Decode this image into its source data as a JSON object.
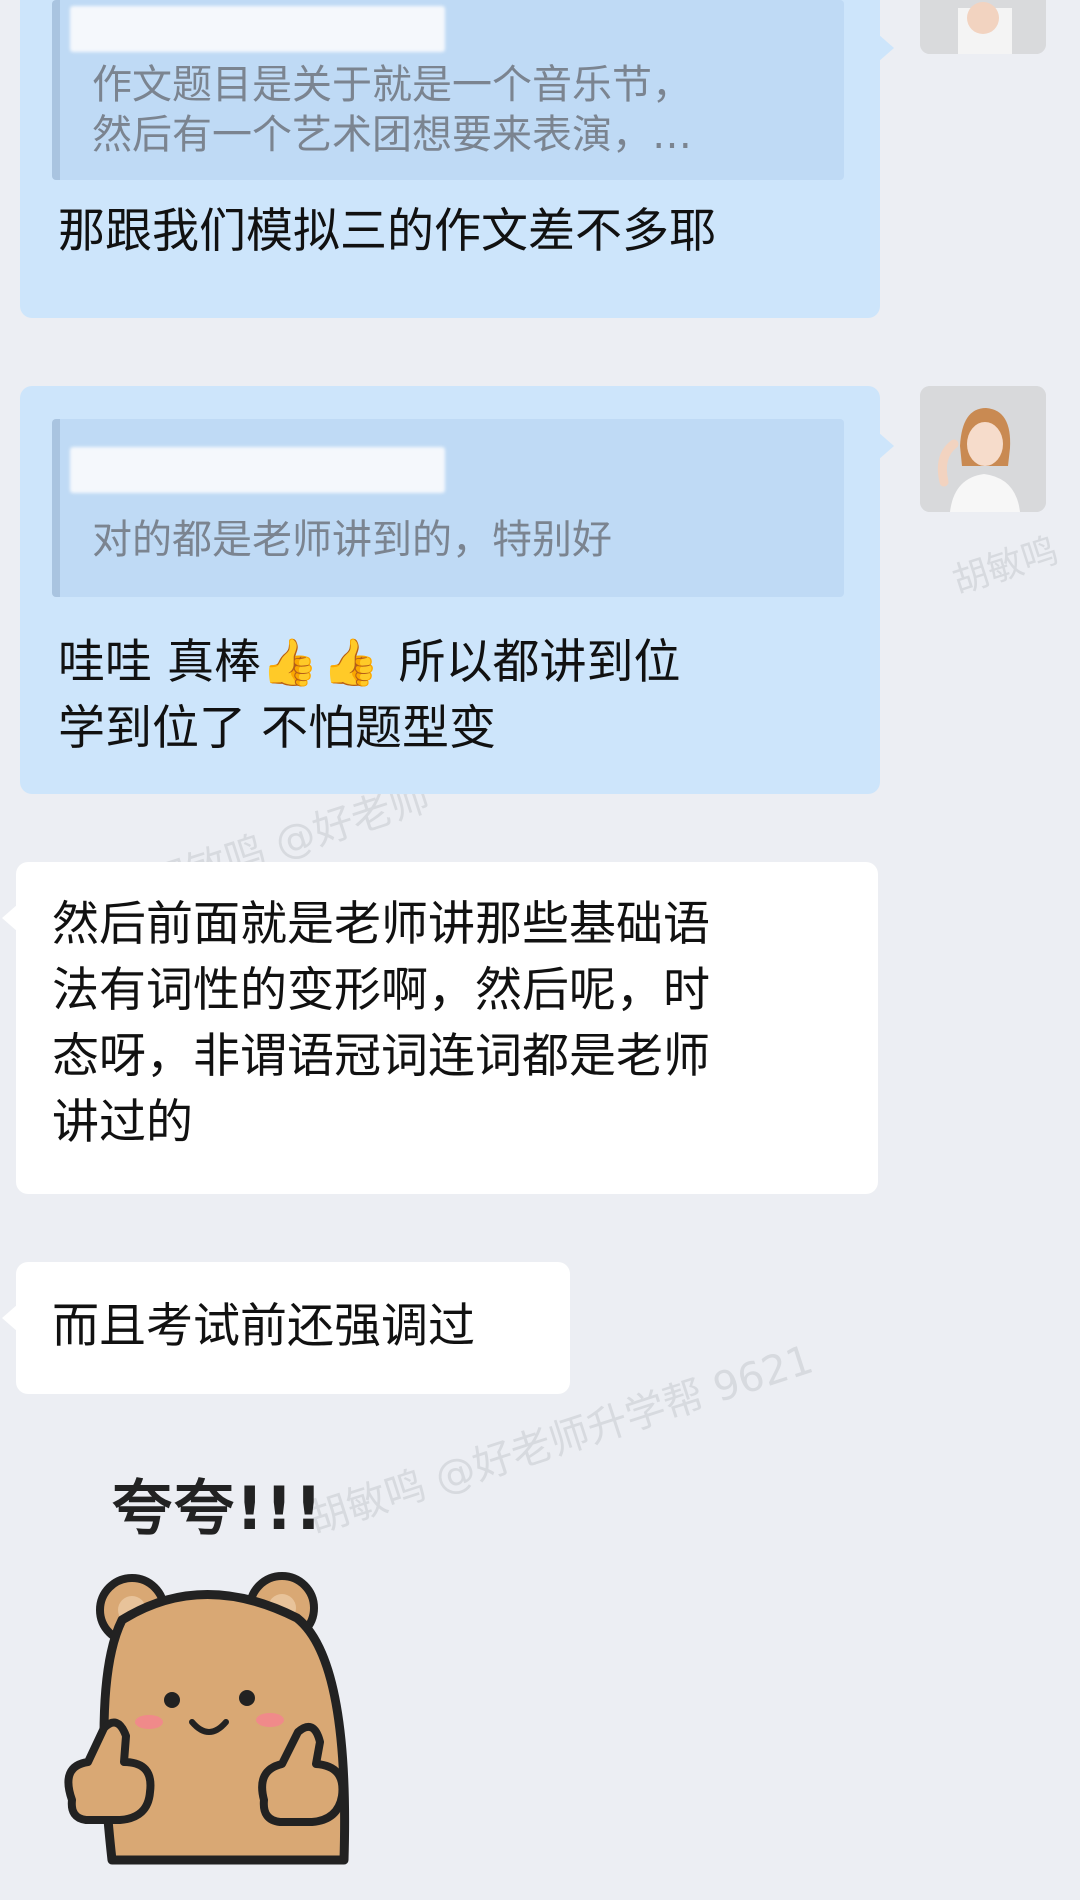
{
  "messages": [
    {
      "side": "right",
      "quote": "作文题目是关于就是一个音乐节，\n然后有一个艺术团想要来表演，…",
      "text": "那跟我们模拟三的作文差不多耶"
    },
    {
      "side": "right",
      "quote": "对的都是老师讲到的，特别好",
      "text_prefix": "哇哇 真棒",
      "emoji": "👍👍",
      "text_suffix": " 所以都讲到位\n学到位了 不怕题型变"
    },
    {
      "side": "left",
      "text": "然后前面就是老师讲那些基础语\n法有词性的变形啊，然后呢，时\n态呀，非谓语冠词连词都是老师\n讲过的"
    },
    {
      "side": "left",
      "text": "而且考试前还强调过"
    }
  ],
  "sticker": {
    "caption": "夸夸!!!",
    "icon": "thumbs-up-bear"
  },
  "watermarks": [
    "胡敏鸣 @好老师升学帮 9621",
    "胡敏鸣",
    "胡敏鸣 @好老师"
  ],
  "colors": {
    "background": "#eceef3",
    "right_bubble": "#cde5fb",
    "left_bubble": "#ffffff",
    "quote_bg": "#bfdaf5"
  }
}
